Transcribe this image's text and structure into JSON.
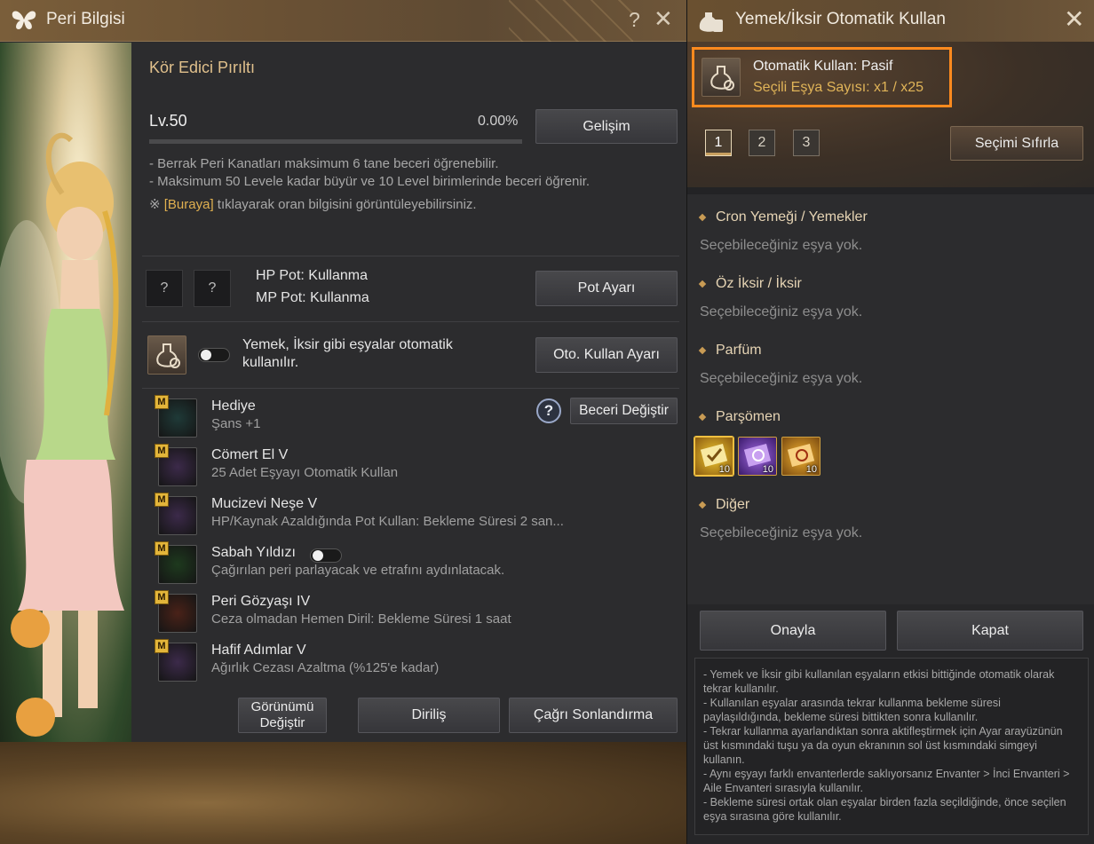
{
  "left": {
    "title": "Peri Bilgisi",
    "help": "?",
    "close": "✕",
    "skill_name": "Kör Edici Pırıltı",
    "level": "Lv.50",
    "percent": "0.00%",
    "progress": 0,
    "gelisim": "Gelişim",
    "desc1": "- Berrak Peri Kanatları maksimum 6 tane beceri öğrenebilir.",
    "desc2": "- Maksimum 50 Levele kadar büyür ve 10 Level birimlerinde beceri öğrenir.",
    "note_mark": "※",
    "note_link": "[Buraya]",
    "note_text": " tıklayarak oran bilgisini görüntüleyebilirsiniz.",
    "slot1": "?",
    "slot2": "?",
    "hp_pot": "HP Pot: Kullanma",
    "mp_pot": "MP Pot: Kullanma",
    "pot_button": "Pot Ayarı",
    "auto_text": "Yemek, İksir gibi eşyalar otomatik kullanılır.",
    "auto_button": "Oto. Kullan Ayarı",
    "beceri_button": "Beceri Değiştir",
    "question": "?",
    "skills": [
      {
        "m": "M",
        "name": "Hediye",
        "desc": "Şans +1",
        "icon_color": "#1f3a38"
      },
      {
        "m": "M",
        "name": "Cömert El V",
        "desc": "25 Adet Eşyayı Otomatik Kullan",
        "icon_color": "#3c2a4a"
      },
      {
        "m": "M",
        "name": "Mucizevi Neşe V",
        "desc": "HP/Kaynak Azaldığında Pot Kullan: Bekleme Süresi 2 san...",
        "icon_color": "#3c2a4a"
      },
      {
        "m": "M",
        "name": "Sabah Yıldızı",
        "desc": "Çağırılan peri parlayacak ve etrafını aydınlatacak.",
        "icon_color": "#1e3a1e"
      },
      {
        "m": "M",
        "name": "Peri Gözyaşı IV",
        "desc": "Ceza olmadan Hemen Diril: Bekleme Süresi 1 saat",
        "icon_color": "#4a2218"
      },
      {
        "m": "M",
        "name": "Hafif Adımlar V",
        "desc": "Ağırlık Cezası Azaltma (%125'e kadar)",
        "icon_color": "#3c2a4a"
      }
    ],
    "appearance_button": "Görünümü Değiştir",
    "revive_button": "Diriliş",
    "end_call_button": "Çağrı Sonlandırma"
  },
  "right": {
    "title": "Yemek/İksir Otomatik Kullan",
    "close": "✕",
    "status": "Otomatik Kullan: Pasif",
    "count": "Seçili Eşya Sayısı: x1 / x25",
    "tabs": [
      "1",
      "2",
      "3"
    ],
    "reset_button": "Seçimi Sıfırla",
    "categories": [
      {
        "label": "Cron Yemeği / Yemekler",
        "empty": "Seçebileceğiniz eşya yok."
      },
      {
        "label": "Öz İksir / İksir",
        "empty": "Seçebileceğiniz eşya yok."
      },
      {
        "label": "Parfüm",
        "empty": "Seçebileceğiniz eşya yok."
      },
      {
        "label": "Parşömen",
        "empty": ""
      },
      {
        "label": "Diğer",
        "empty": "Seçebileceğiniz eşya yok."
      }
    ],
    "scrolls": [
      {
        "qty": "10",
        "color": "#d8a820"
      },
      {
        "qty": "10",
        "color": "#6a38b0"
      },
      {
        "qty": "10",
        "color": "#d89820"
      }
    ],
    "confirm_button": "Onayla",
    "close_button": "Kapat",
    "info": "- Yemek ve İksir gibi kullanılan eşyaların etkisi bittiğinde otomatik olarak tekrar kullanılır.\n- Kullanılan eşyalar arasında tekrar kullanma bekleme süresi paylaşıldığında, bekleme süresi bittikten sonra kullanılır.\n- Tekrar kullanma ayarlandıktan sonra aktifleştirmek için Ayar arayüzünün üst kısmındaki tuşu ya da oyun ekranının sol üst kısmındaki simgeyi kullanın.\n- Aynı eşyayı farklı envanterlerde saklıyorsanız Envanter > İnci Envanteri > Aile Envanteri sırasıyla kullanılır.\n- Bekleme süresi ortak olan eşyalar birden fazla seçildiğinde, önce seçilen eşya sırasına göre kullanılır."
  }
}
